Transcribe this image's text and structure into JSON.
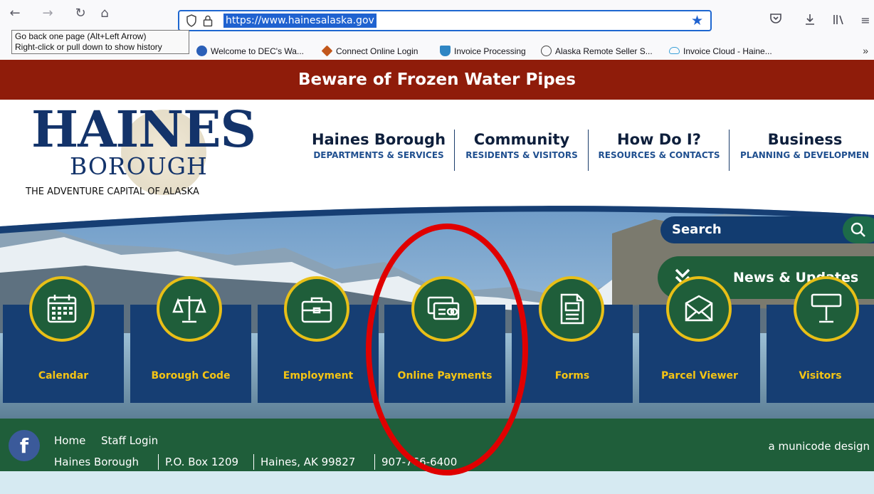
{
  "browser": {
    "url": "https://www.hainesalaska.gov",
    "tooltip_line1": "Go back one page (Alt+Left Arrow)",
    "tooltip_line2": "Right-click or pull down to show history",
    "bookmarks": [
      {
        "label": "Welcome to DEC's Wa...",
        "icon": "globe-icon",
        "color": "#2b5fb8"
      },
      {
        "label": "Connect Online Login",
        "icon": "diamond-icon",
        "color": "#c2571b"
      },
      {
        "label": "Invoice Processing",
        "icon": "cup-icon",
        "color": "#2f86c4"
      },
      {
        "label": "Alaska Remote Seller S...",
        "icon": "globe-outline-icon",
        "color": "#444444"
      },
      {
        "label": "Invoice Cloud - Haine...",
        "icon": "cloud-icon",
        "color": "#3aa0d8"
      }
    ]
  },
  "alert": {
    "text": "Beware of Frozen Water Pipes"
  },
  "logo": {
    "haines": "HAINES",
    "borough": "BOROUGH",
    "tagline": "THE ADVENTURE CAPITAL OF ALASKA"
  },
  "menu": [
    {
      "title": "Haines Borough",
      "sub": "DEPARTMENTS & SERVICES"
    },
    {
      "title": "Community",
      "sub": "RESIDENTS & VISITORS"
    },
    {
      "title": "How Do I?",
      "sub": "RESOURCES & CONTACTS"
    },
    {
      "title": "Business",
      "sub": "PLANNING & DEVELOPMEN"
    }
  ],
  "hero": {
    "search_label": "Search",
    "news_label": "News & Updates",
    "tiles": [
      {
        "label": "Calendar",
        "icon": "calendar-icon"
      },
      {
        "label": "Borough Code",
        "icon": "scales-icon"
      },
      {
        "label": "Employment",
        "icon": "briefcase-icon"
      },
      {
        "label": "Online Payments",
        "icon": "credit-card-icon"
      },
      {
        "label": "Forms",
        "icon": "document-icon"
      },
      {
        "label": "Parcel Viewer",
        "icon": "map-icon"
      },
      {
        "label": "Visitors",
        "icon": "sign-icon"
      }
    ]
  },
  "footer": {
    "home": "Home",
    "staff_login": "Staff Login",
    "org": "Haines Borough",
    "po_box": "P.O. Box 1209",
    "city": "Haines, AK 99827",
    "phone": "907-766-6400",
    "credit": "a municode design"
  },
  "colors": {
    "alert_bg": "#8f1c0a",
    "navy": "#163e73",
    "green": "#1f5e3a",
    "gold": "#e8bf17",
    "annotation": "#e00000"
  }
}
